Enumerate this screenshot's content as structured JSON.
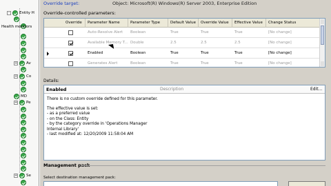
{
  "tree": {
    "root_label": "Entity H",
    "health_monitors_label": "Health monitors",
    "rows": [
      {
        "expander": "-",
        "label": "Entity H"
      },
      {
        "expander": "",
        "label": ""
      },
      {
        "expander": "",
        "label": ""
      },
      {
        "expander": "",
        "label": ""
      },
      {
        "expander": "",
        "label": ""
      },
      {
        "expander": "",
        "label": ""
      },
      {
        "expander": "",
        "label": ""
      },
      {
        "expander": "+",
        "label": "Av"
      },
      {
        "expander": "",
        "label": ""
      },
      {
        "expander": "+",
        "label": "Co"
      },
      {
        "expander": "",
        "label": ""
      },
      {
        "expander": "",
        "label": ""
      },
      {
        "expander": "",
        "label": "MD"
      },
      {
        "expander": "+",
        "label": "Pe"
      },
      {
        "expander": "",
        "label": ""
      },
      {
        "expander": "",
        "label": ""
      },
      {
        "expander": "",
        "label": ""
      },
      {
        "expander": "",
        "label": ""
      },
      {
        "expander": "",
        "label": ""
      },
      {
        "expander": "",
        "label": ""
      },
      {
        "expander": "",
        "label": ""
      },
      {
        "expander": "",
        "label": ""
      },
      {
        "expander": "",
        "label": ""
      },
      {
        "expander": "",
        "label": ""
      },
      {
        "expander": "+",
        "label": "Se"
      },
      {
        "expander": "",
        "label": ""
      }
    ]
  },
  "header": {
    "override_target_label": "Override target:",
    "object_value": "Object: Microsoft(R) Windows(R) Server 2003, Enterprise Edition"
  },
  "grid": {
    "section_label": "Override-controlled parameters:",
    "columns": [
      "Override",
      "Parameter Name",
      "Parameter Type",
      "Default Value",
      "Override Value",
      "Effective Value",
      "Change Status"
    ],
    "rows": [
      {
        "checked": false,
        "name": "Auto-Resolve Alert",
        "type": "Boolean",
        "default": "True",
        "override": "True",
        "effective": "True",
        "status": "[No change]",
        "selected": false
      },
      {
        "checked": true,
        "name": "Available Memory T...",
        "type": "Double",
        "default": "2.5",
        "override": "2.5",
        "effective": "2.5",
        "status": "[No change]",
        "selected": false
      },
      {
        "checked": true,
        "name": "Enabled",
        "type": "Boolean",
        "default": "True",
        "override": "True",
        "effective": "True",
        "status": "[No change]",
        "selected": true
      },
      {
        "checked": false,
        "name": "Generates Alert",
        "type": "Boolean",
        "default": "True",
        "override": "True",
        "effective": "True",
        "status": "[No change]",
        "selected": false
      }
    ]
  },
  "details": {
    "section_label": "Details:",
    "title": "Enabled",
    "description_label": "Description",
    "edit_label": "Edit...",
    "lines": [
      "There is no custom override defined for this parameter.",
      "",
      "The effective value is set:",
      " - as a preferred value",
      " - on the Class: Entity",
      " - by the category override in 'Operations Manager",
      "Internal Library'",
      " - last modified at: 12/20/2009 11:58:04 AM"
    ]
  },
  "management_pack": {
    "section_label": "Management pack",
    "select_label": "Select destination management pack:"
  }
}
